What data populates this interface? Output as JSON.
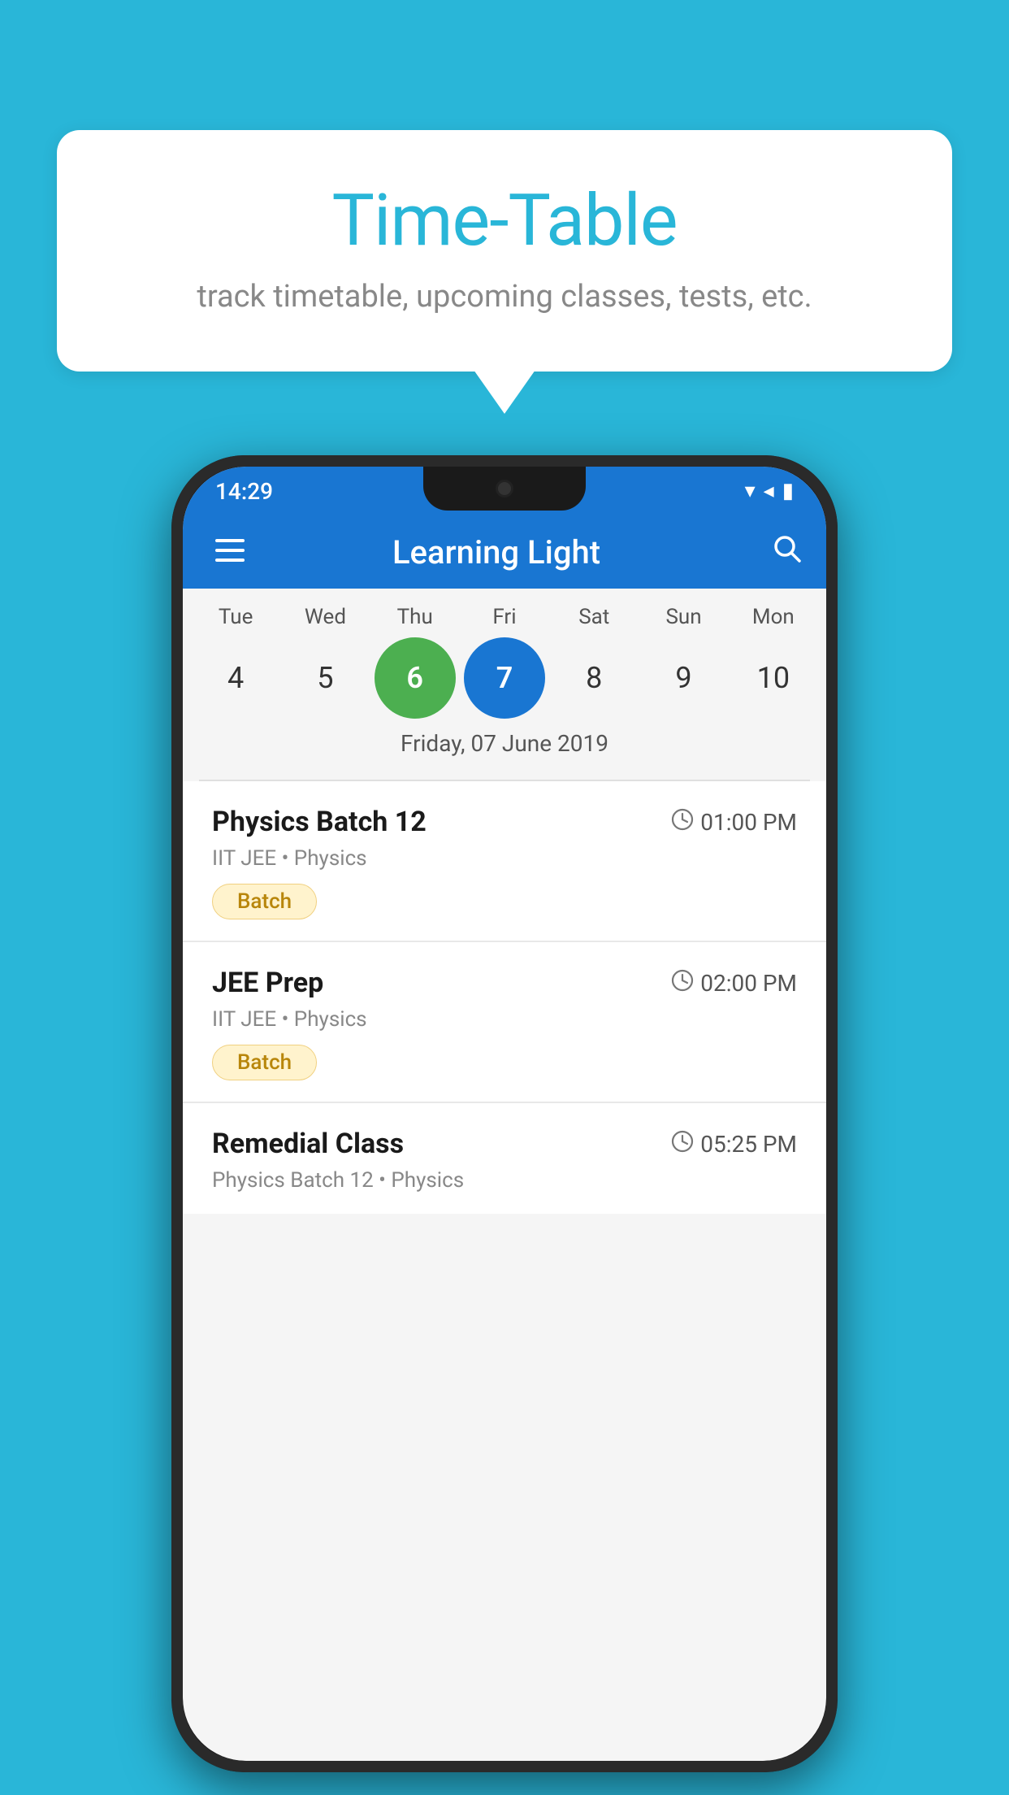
{
  "background_color": "#29b6d8",
  "speech_bubble": {
    "title": "Time-Table",
    "subtitle": "track timetable, upcoming classes, tests, etc."
  },
  "phone": {
    "status_bar": {
      "time": "14:29"
    },
    "app_bar": {
      "title": "Learning Light"
    },
    "calendar": {
      "day_headers": [
        "Tue",
        "Wed",
        "Thu",
        "Fri",
        "Sat",
        "Sun",
        "Mon"
      ],
      "day_numbers": [
        {
          "num": "4",
          "state": "normal"
        },
        {
          "num": "5",
          "state": "normal"
        },
        {
          "num": "6",
          "state": "today"
        },
        {
          "num": "7",
          "state": "selected"
        },
        {
          "num": "8",
          "state": "normal"
        },
        {
          "num": "9",
          "state": "normal"
        },
        {
          "num": "10",
          "state": "normal"
        }
      ],
      "selected_date_label": "Friday, 07 June 2019"
    },
    "schedule": [
      {
        "title": "Physics Batch 12",
        "time": "01:00 PM",
        "subtitle": "IIT JEE • Physics",
        "tag": "Batch"
      },
      {
        "title": "JEE Prep",
        "time": "02:00 PM",
        "subtitle": "IIT JEE • Physics",
        "tag": "Batch"
      },
      {
        "title": "Remedial Class",
        "time": "05:25 PM",
        "subtitle": "Physics Batch 12 • Physics",
        "tag": null
      }
    ]
  }
}
